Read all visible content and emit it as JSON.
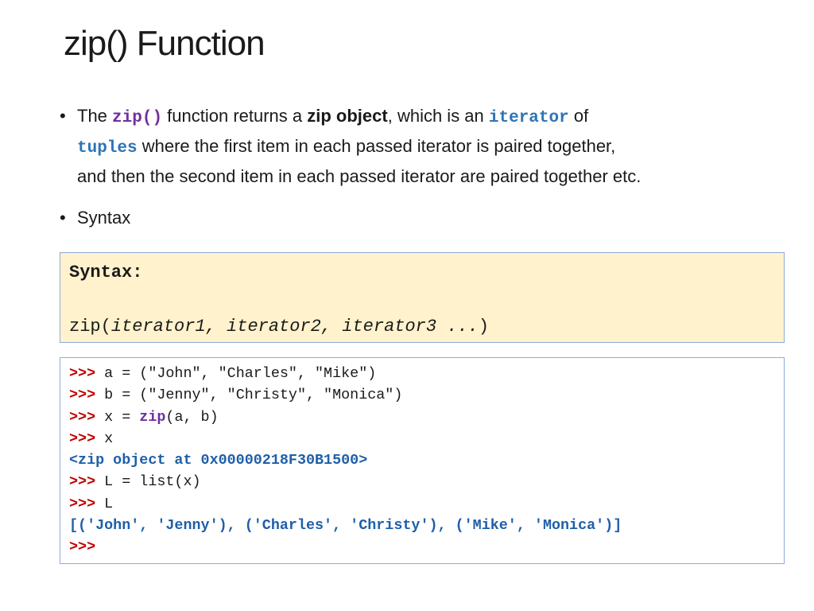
{
  "title": "zip() Function",
  "bullets": [
    {
      "pre": "The ",
      "code_zip": "zip()",
      "mid1": " function returns a ",
      "bold": "zip object",
      "mid2": ", which is an ",
      "code_iterator": "iterator",
      "mid3": " of",
      "code_tuples": "tuples",
      "rest_line2": " where the first item in each passed iterator is paired together,",
      "line3": "and then the second item in each passed iterator are paired together etc."
    },
    {
      "text": "Syntax"
    }
  ],
  "bullet_marker": "•",
  "syntax_box": {
    "label": "Syntax:",
    "call_name": "zip(",
    "args": "iterator1, iterator2, iterator3 ...",
    "close": ")"
  },
  "shell": {
    "prompt": ">>>",
    "lines": [
      {
        "type": "cmd",
        "text": " a = (\"John\", \"Charles\", \"Mike\")"
      },
      {
        "type": "cmd",
        "text": " b = (\"Jenny\", \"Christy\", \"Monica\")"
      },
      {
        "type": "cmd_zip",
        "pre": " x = ",
        "kw": "zip",
        "post": "(a, b)"
      },
      {
        "type": "cmd",
        "text": " x"
      },
      {
        "type": "out",
        "text": "<zip object at 0x00000218F30B1500>"
      },
      {
        "type": "cmd",
        "text": " L = list(x)"
      },
      {
        "type": "cmd",
        "text": " L"
      },
      {
        "type": "out",
        "text": "[('John', 'Jenny'), ('Charles', 'Christy'), ('Mike', 'Monica')]"
      },
      {
        "type": "prompt_only"
      }
    ]
  },
  "colors": {
    "code_purple": "#7030a0",
    "code_blue": "#2e74b5",
    "prompt_red": "#c00000",
    "output_blue": "#1f5fa8",
    "syntax_bg": "#fff2cc",
    "box_border": "#8eaadb"
  }
}
